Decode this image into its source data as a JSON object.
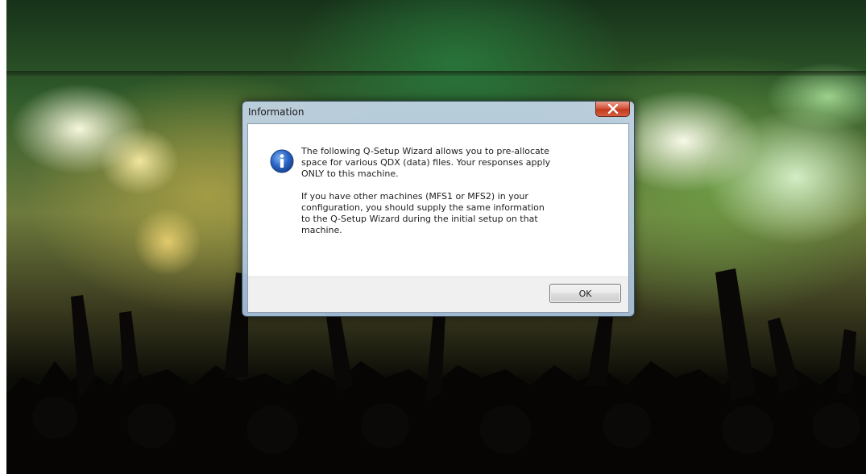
{
  "dialog": {
    "title": "Information",
    "icon": "information-icon",
    "message_paragraph_1": "The following Q-Setup Wizard allows you to pre-allocate\nspace for various QDX (data) files.  Your responses apply\nONLY to this machine.",
    "message_paragraph_2": "If you have other machines (MFS1 or MFS2) in your\nconfiguration, you should supply the same information\nto the Q-Setup Wizard during the initial setup on that\nmachine.",
    "ok_label": "OK",
    "close_icon": "close-icon"
  },
  "desktop": {
    "wallpaper": "concert-crowd-wallpaper"
  },
  "colors": {
    "close_button": "#c7402a",
    "info_icon": "#2a64c5",
    "frame": "#aec6df"
  }
}
